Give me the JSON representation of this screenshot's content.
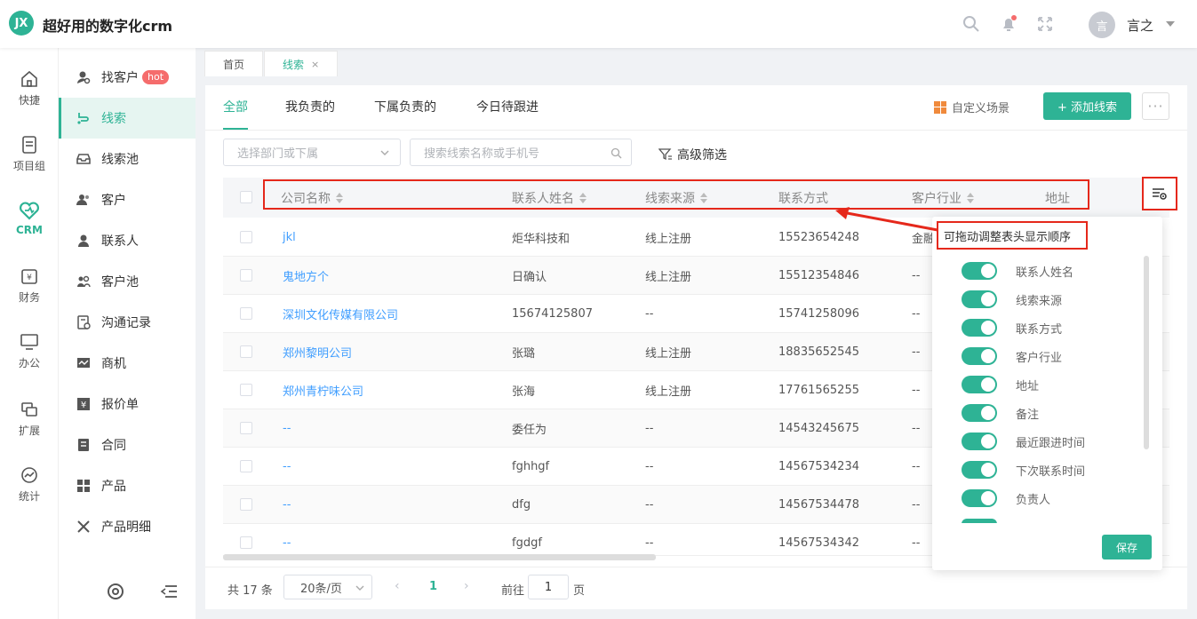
{
  "header": {
    "logo_text": "JX",
    "title": "超好用的数字化crm",
    "avatar_text": "言",
    "username": "言之"
  },
  "rail": [
    {
      "label": "快捷",
      "icon": "home-icon"
    },
    {
      "label": "项目组",
      "icon": "document-icon"
    },
    {
      "label": "CRM",
      "icon": "crm-heart-icon",
      "active": true
    },
    {
      "label": "财务",
      "icon": "wallet-icon"
    },
    {
      "label": "办公",
      "icon": "monitor-icon"
    },
    {
      "label": "扩展",
      "icon": "extension-icon"
    },
    {
      "label": "统计",
      "icon": "chart-icon"
    }
  ],
  "submenu": [
    {
      "label": "找客户",
      "badge": "hot",
      "icon": "find-customer-icon"
    },
    {
      "label": "线索",
      "icon": "lead-icon",
      "active": true
    },
    {
      "label": "线索池",
      "icon": "lead-pool-icon"
    },
    {
      "label": "客户",
      "icon": "customer-icon"
    },
    {
      "label": "联系人",
      "icon": "contact-icon"
    },
    {
      "label": "客户池",
      "icon": "customer-pool-icon"
    },
    {
      "label": "沟通记录",
      "icon": "record-icon"
    },
    {
      "label": "商机",
      "icon": "opportunity-icon"
    },
    {
      "label": "报价单",
      "icon": "quote-icon"
    },
    {
      "label": "合同",
      "icon": "contract-icon"
    },
    {
      "label": "产品",
      "icon": "product-icon"
    },
    {
      "label": "产品明细",
      "icon": "product-detail-icon"
    }
  ],
  "page_tabs": [
    {
      "label": "首页"
    },
    {
      "label": "线索",
      "close": "×",
      "active": true
    }
  ],
  "filter_tabs": [
    "全部",
    "我负责的",
    "下属负责的",
    "今日待跟进"
  ],
  "toolbar": {
    "scene_label": "自定义场景",
    "add_label": "+ 添加线索",
    "more": "···"
  },
  "search": {
    "dept_placeholder": "选择部门或下属",
    "keyword_placeholder": "搜索线索名称或手机号",
    "advanced_filter": "高级筛选"
  },
  "table": {
    "columns": [
      "公司名称",
      "联系人姓名",
      "线索来源",
      "联系方式",
      "客户行业",
      "地址"
    ],
    "rows": [
      [
        "jkl",
        "炬华科技和",
        "线上注册",
        "15523654248",
        "金融"
      ],
      [
        "鬼地方个",
        "日确认",
        "线上注册",
        "15512354846",
        "--"
      ],
      [
        "深圳文化传媒有限公司",
        "15674125807",
        "--",
        "15741258096",
        "--"
      ],
      [
        "郑州黎明公司",
        "张璐",
        "线上注册",
        "18835652545",
        "--"
      ],
      [
        "郑州青柠味公司",
        "张海",
        "线上注册",
        "17761565255",
        "--"
      ],
      [
        "--",
        "委任为",
        "--",
        "14543245675",
        "--"
      ],
      [
        "--",
        "fghhgf",
        "--",
        "14567534234",
        "--"
      ],
      [
        "--",
        "dfg",
        "--",
        "14567534478",
        "--"
      ],
      [
        "--",
        "fgdgf",
        "--",
        "14567534342",
        "--"
      ]
    ]
  },
  "pagination": {
    "total": "共 17 条",
    "page_size": "20条/页",
    "current": "1",
    "goto_label": "前往",
    "goto_value": "1",
    "page_unit": "页"
  },
  "column_popover": {
    "hint": "可拖动调整表头显示顺序",
    "items": [
      "联系人姓名",
      "线索来源",
      "联系方式",
      "客户行业",
      "地址",
      "备注",
      "最近跟进时间",
      "下次联系时间",
      "负责人"
    ],
    "save_label": "保存"
  }
}
